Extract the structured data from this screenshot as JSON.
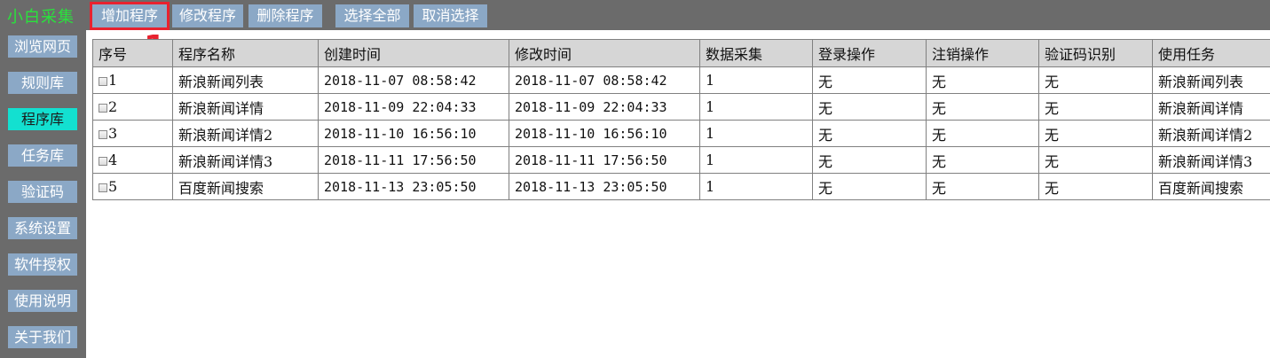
{
  "app": {
    "title": "小白采集"
  },
  "toolbar": {
    "add_label": "增加程序",
    "edit_label": "修改程序",
    "delete_label": "删除程序",
    "select_all_label": "选择全部",
    "deselect_label": "取消选择"
  },
  "annotation": {
    "marker": "1"
  },
  "sidebar": {
    "items": [
      {
        "label": "浏览网页",
        "active": false
      },
      {
        "label": "规则库",
        "active": false
      },
      {
        "label": "程序库",
        "active": true
      },
      {
        "label": "任务库",
        "active": false
      },
      {
        "label": "验证码",
        "active": false
      },
      {
        "label": "系统设置",
        "active": false
      },
      {
        "label": "软件授权",
        "active": false
      },
      {
        "label": "使用说明",
        "active": false
      },
      {
        "label": "关于我们",
        "active": false
      }
    ]
  },
  "table": {
    "headers": [
      "序号",
      "程序名称",
      "创建时间",
      "修改时间",
      "数据采集",
      "登录操作",
      "注销操作",
      "验证码识别",
      "使用任务"
    ],
    "rows": [
      {
        "id": "1",
        "name": "新浪新闻列表",
        "created": "2018-11-07 08:58:42",
        "modified": "2018-11-07 08:58:42",
        "collect": "1",
        "login": "无",
        "logout": "无",
        "captcha": "无",
        "task": "新浪新闻列表"
      },
      {
        "id": "2",
        "name": "新浪新闻详情",
        "created": "2018-11-09 22:04:33",
        "modified": "2018-11-09 22:04:33",
        "collect": "1",
        "login": "无",
        "logout": "无",
        "captcha": "无",
        "task": "新浪新闻详情"
      },
      {
        "id": "3",
        "name": "新浪新闻详情2",
        "created": "2018-11-10 16:56:10",
        "modified": "2018-11-10 16:56:10",
        "collect": "1",
        "login": "无",
        "logout": "无",
        "captcha": "无",
        "task": "新浪新闻详情2"
      },
      {
        "id": "4",
        "name": "新浪新闻详情3",
        "created": "2018-11-11 17:56:50",
        "modified": "2018-11-11 17:56:50",
        "collect": "1",
        "login": "无",
        "logout": "无",
        "captcha": "无",
        "task": "新浪新闻详情3"
      },
      {
        "id": "5",
        "name": "百度新闻搜索",
        "created": "2018-11-13 23:05:50",
        "modified": "2018-11-13 23:05:50",
        "collect": "1",
        "login": "无",
        "logout": "无",
        "captcha": "无",
        "task": "百度新闻搜索"
      }
    ]
  },
  "colors": {
    "chrome_bg": "#6b6b6b",
    "button_bg": "#8ba8c6",
    "active_nav_bg": "#13e0d0",
    "title_green": "#29e33c",
    "highlight_red": "#e8222f",
    "header_bg": "#d6d6d6"
  }
}
